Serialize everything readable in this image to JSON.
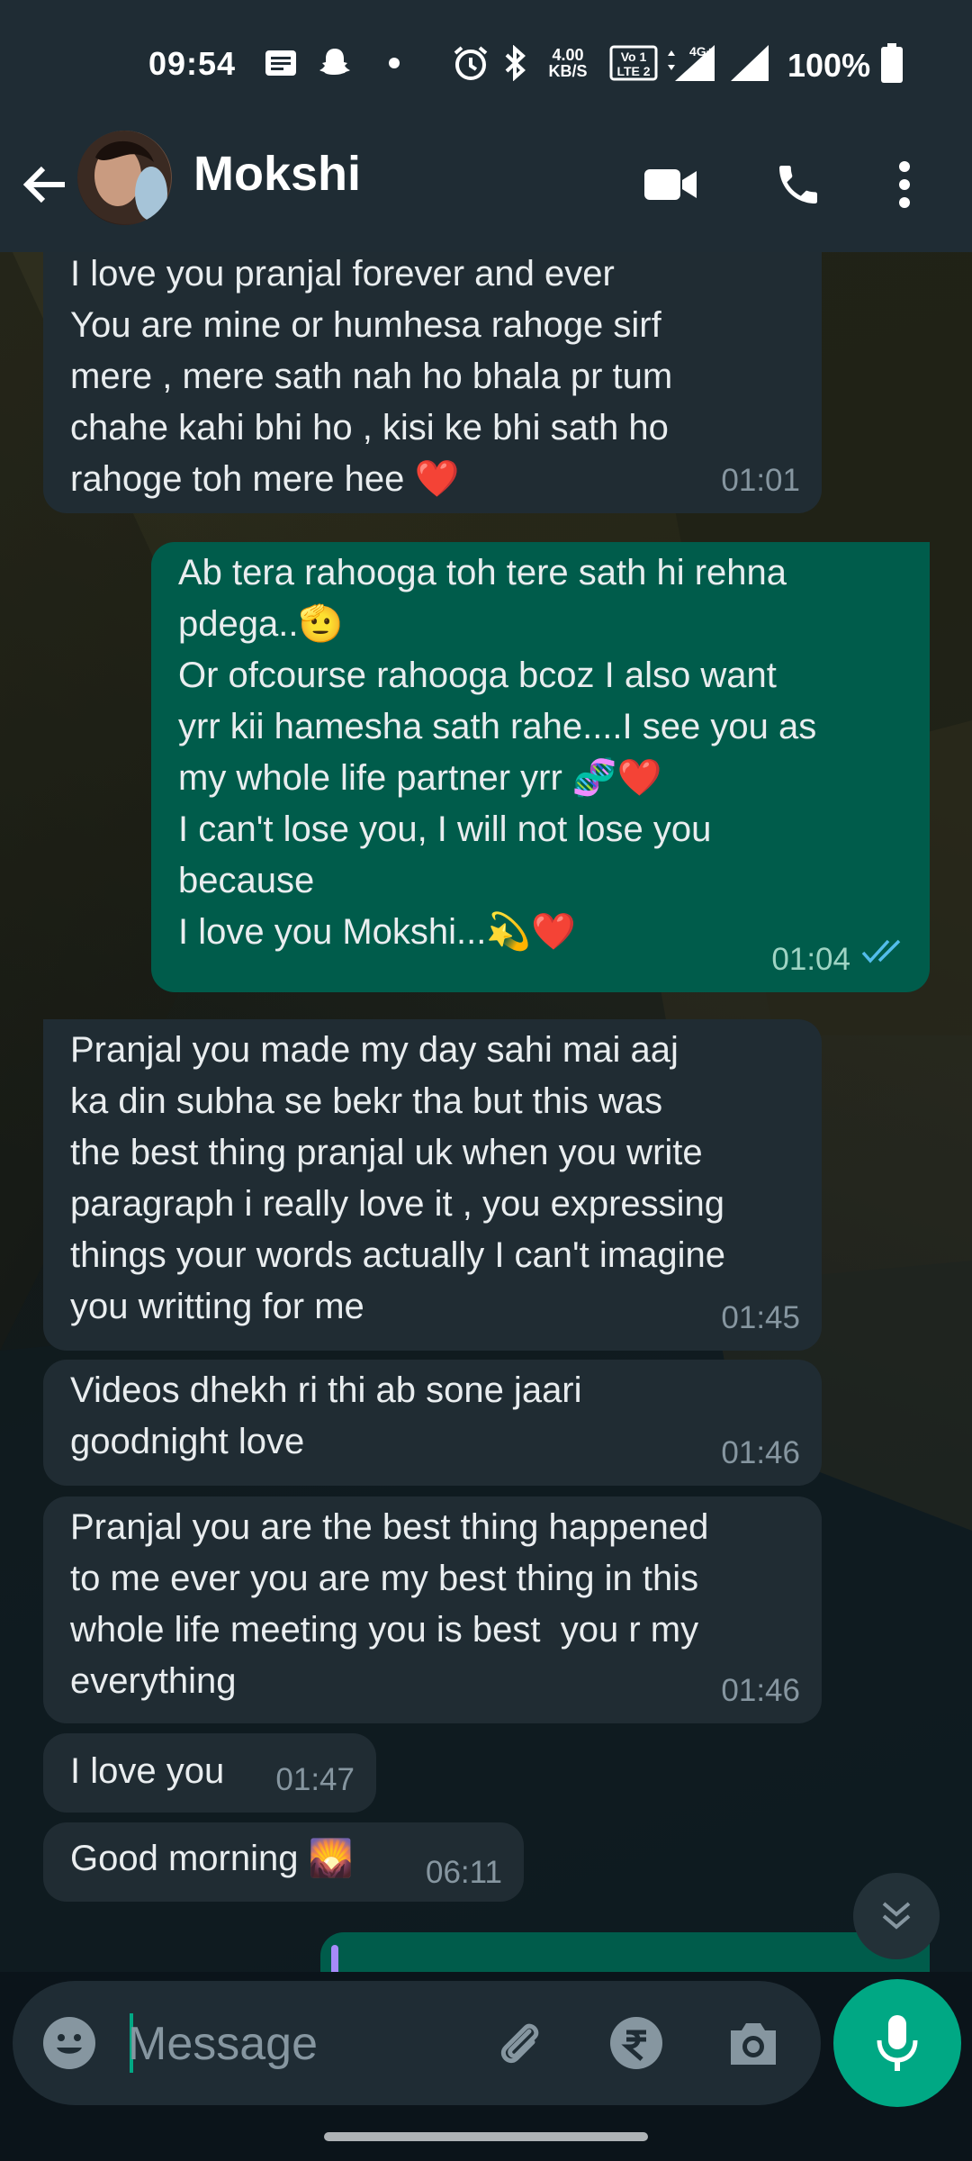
{
  "status_bar": {
    "time": "09:54",
    "net_speed": "4.00 KB/S",
    "volte": "Vo LTE",
    "network": "4G+",
    "battery_pct": "100%",
    "icons": [
      "message-icon",
      "snapchat-icon",
      "dot-icon",
      "alarm-icon",
      "bluetooth-icon",
      "volte-icon",
      "data-arrows-icon",
      "signal-icon",
      "signal-icon",
      "battery-icon"
    ]
  },
  "header": {
    "contact_name": "Mokshi",
    "icons": [
      "back-arrow-icon",
      "video-call-icon",
      "phone-icon",
      "more-vert-icon"
    ]
  },
  "messages": [
    {
      "direction": "in",
      "text": "I love you pranjal forever and ever\nYou are mine or humhesa rahoge sirf\nmere , mere sath nah ho bhala pr tum\nchahe kahi bhi ho , kisi ke bhi sath ho\nrahoge toh mere hee ❤️",
      "time": "01:01"
    },
    {
      "direction": "out",
      "text": "Ab tera rahooga toh tere sath hi rehna\npdega..🫡\nOr ofcourse rahooga bcoz I also want\nyrr kii hamesha sath rahe....I see you as\nmy whole life partner yrr 🧬❤️\nI can't lose you, I will not lose you\nbecause\nI love you Mokshi...💫❤️",
      "time": "01:04",
      "status": "read"
    },
    {
      "direction": "in",
      "text": "Pranjal you made my day sahi mai aaj\nka din subha se bekr tha but this was\nthe best thing pranjal uk when you write\nparagraph i really love it , you expressing\nthings your words actually I can't imagine\nyou writting for me",
      "time": "01:45"
    },
    {
      "direction": "in",
      "text": "Videos dhekh ri thi ab sone jaari\ngoodnight love",
      "time": "01:46"
    },
    {
      "direction": "in",
      "text": "Pranjal you are the best thing happened\nto me ever you are my best thing in this\nwhole life meeting you is best  you r my\neverything",
      "time": "01:46"
    },
    {
      "direction": "in",
      "text": "I love you",
      "time": "01:47"
    },
    {
      "direction": "in",
      "text": "Good morning 🌄",
      "time": "06:11"
    }
  ],
  "composer": {
    "placeholder": "Message",
    "icons": [
      "emoji-icon",
      "attach-icon",
      "rupee-icon",
      "camera-icon",
      "mic-icon"
    ]
  },
  "colors": {
    "header_bg": "#1f2c34",
    "incoming_bubble": "#202c33",
    "outgoing_bubble": "#005c4b",
    "accent": "#00a884",
    "read_tick": "#53bdeb"
  }
}
